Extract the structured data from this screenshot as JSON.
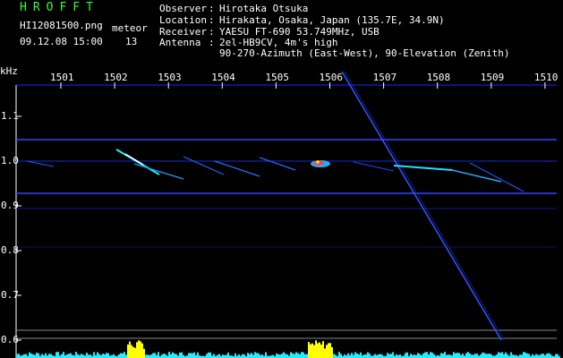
{
  "header": {
    "app_title": "HROFFT",
    "filename": "HI12081500.png",
    "datetime": "09.12.08 15:00",
    "meteor_label": "meteor",
    "meteor_count": "13",
    "observer_label": "Observer",
    "observer": "Hirotaka Otsuka",
    "location_label": "Location",
    "location": "Hirakata, Osaka, Japan (135.7E, 34.9N)",
    "receiver_label": "Receiver",
    "receiver": "YAESU FT-690 53.749MHz, USB",
    "antenna_label": "Antenna",
    "antenna_line1": "2el-HB9CV, 4m's high",
    "antenna_line2": "90-270-Azimuth (East-West), 90-Elevation (Zenith)"
  },
  "axis": {
    "unit": "kHz",
    "x_ticks": [
      "1501",
      "1502",
      "1503",
      "1504",
      "1505",
      "1506",
      "1507",
      "1508",
      "1509",
      "1510"
    ],
    "y_ticks": [
      "1.1",
      "1.0",
      "0.9",
      "0.8",
      "0.7",
      "0.6"
    ]
  },
  "colors": {
    "title": "#33ff33",
    "header_text": "#ffffff",
    "grid_blue": "#2222ff",
    "trace_cyan": "#22eeff",
    "spectrum_yellow": "#ffff00"
  }
}
